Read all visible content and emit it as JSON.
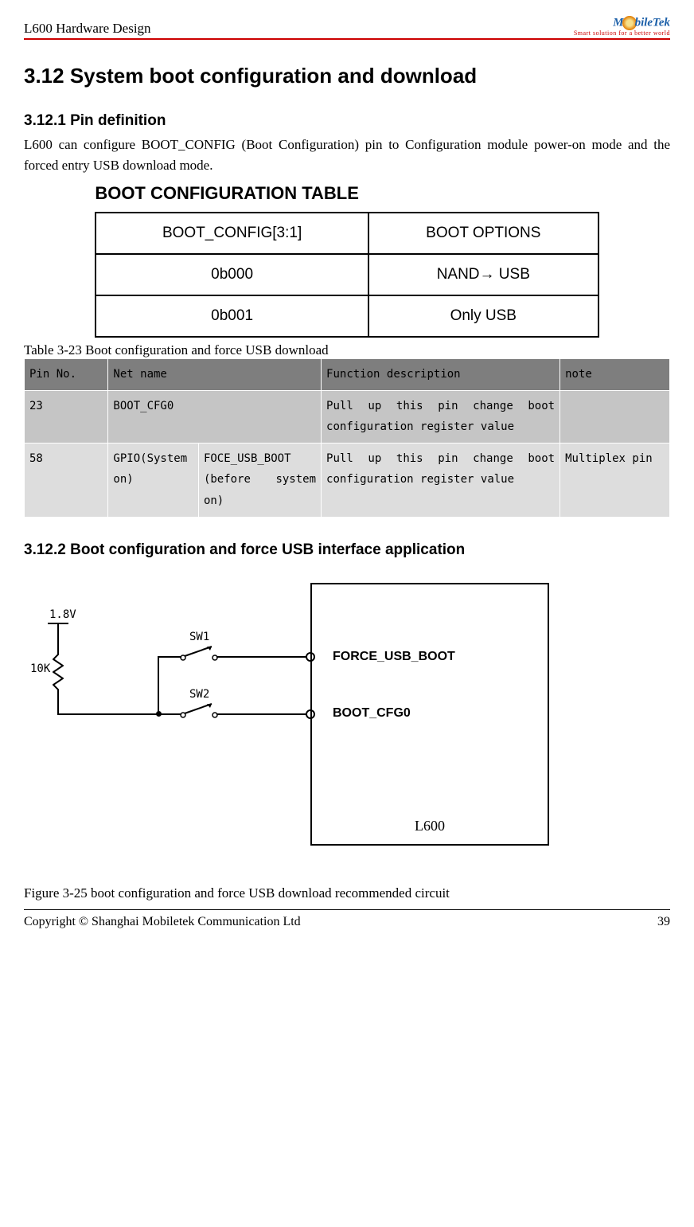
{
  "header": {
    "doc_title": "L600 Hardware Design",
    "brand_part1": "M",
    "brand_part2": "bileTek",
    "tagline": "Smart solution for a better world"
  },
  "section": {
    "number_title": "3.12 System boot configuration and download"
  },
  "sub1": {
    "title": "3.12.1 Pin definition",
    "paragraph": "L600 can configure BOOT_CONFIG (Boot Configuration) pin to Configuration module power-on mode and the forced entry USB download mode."
  },
  "cfg_table": {
    "title": "BOOT CONFIGURATION TABLE",
    "h1": "BOOT_CONFIG[3:1]",
    "h2": "BOOT OPTIONS",
    "r1c1": "0b000",
    "r1c2": "NAND→ USB",
    "r2c1": "0b001",
    "r2c2": "Only USB"
  },
  "pin_table": {
    "caption": "Table 3-23 Boot configuration and force USB download",
    "head": {
      "c1": "Pin No.",
      "c2": "Net name",
      "c3": "Function description",
      "c4": "note"
    },
    "row1": {
      "c1": "23",
      "c2": "BOOT_CFG0",
      "c3": "Pull up this pin change boot configuration register value",
      "c4": ""
    },
    "row2": {
      "c1": "58",
      "c2a": "GPIO(System on)",
      "c2b": "FOCE_USB_BOOT (before system on)",
      "c3": "Pull up this pin change boot configuration register value",
      "c4": "Multiplex pin"
    }
  },
  "sub2": {
    "title": "3.12.2 Boot configuration and force USB interface application"
  },
  "schematic": {
    "v_label": "1.8V",
    "r_label": "10K",
    "sw1": "SW1",
    "sw2": "SW2",
    "pin1": "FORCE_USB_BOOT",
    "pin2": "BOOT_CFG0",
    "box": "L600"
  },
  "figure_caption": "Figure 3-25 boot configuration and force USB download recommended circuit",
  "footer": {
    "left": "Copyright © Shanghai Mobiletek Communication Ltd",
    "right": "39"
  }
}
